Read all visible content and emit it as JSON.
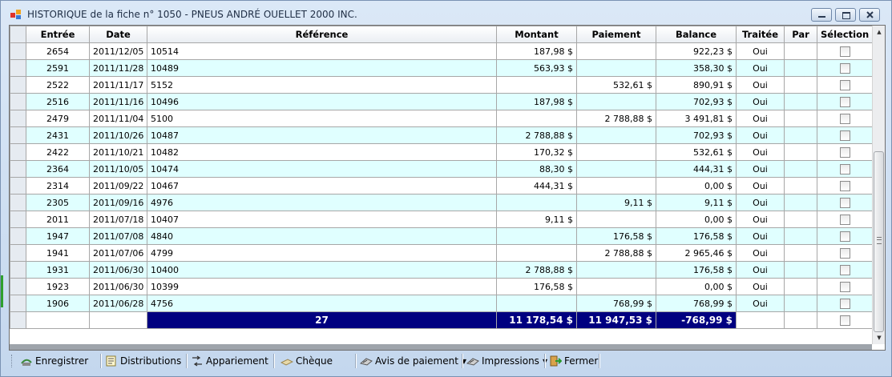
{
  "window": {
    "title": "HISTORIQUE de la fiche n° 1050 - PNEUS ANDRÉ OUELLET 2000 INC.",
    "icons": {
      "app": "app-window-icon",
      "minimize": "minimize-icon",
      "maximize": "maximize-icon",
      "close": "close-icon"
    }
  },
  "grid": {
    "columns": [
      "Entrée",
      "Date",
      "Référence",
      "Montant",
      "Paiement",
      "Balance",
      "Traitée",
      "Par",
      "Sélection"
    ],
    "rows": [
      {
        "entree": "2654",
        "date": "2011/12/05",
        "reference": "10514",
        "montant": "187,98 $",
        "paiement": "",
        "balance": "922,23 $",
        "traitee": "Oui",
        "par": "",
        "selected": false
      },
      {
        "entree": "2591",
        "date": "2011/11/28",
        "reference": "10489",
        "montant": "563,93 $",
        "paiement": "",
        "balance": "358,30 $",
        "traitee": "Oui",
        "par": "",
        "selected": false
      },
      {
        "entree": "2522",
        "date": "2011/11/17",
        "reference": "5152",
        "montant": "",
        "paiement": "532,61 $",
        "balance": "890,91 $",
        "traitee": "Oui",
        "par": "",
        "selected": false
      },
      {
        "entree": "2516",
        "date": "2011/11/16",
        "reference": "10496",
        "montant": "187,98 $",
        "paiement": "",
        "balance": "702,93 $",
        "traitee": "Oui",
        "par": "",
        "selected": false
      },
      {
        "entree": "2479",
        "date": "2011/11/04",
        "reference": "5100",
        "montant": "",
        "paiement": "2 788,88 $",
        "balance": "3 491,81 $",
        "traitee": "Oui",
        "par": "",
        "selected": false
      },
      {
        "entree": "2431",
        "date": "2011/10/26",
        "reference": "10487",
        "montant": "2 788,88 $",
        "paiement": "",
        "balance": "702,93 $",
        "traitee": "Oui",
        "par": "",
        "selected": false
      },
      {
        "entree": "2422",
        "date": "2011/10/21",
        "reference": "10482",
        "montant": "170,32 $",
        "paiement": "",
        "balance": "532,61 $",
        "traitee": "Oui",
        "par": "",
        "selected": false
      },
      {
        "entree": "2364",
        "date": "2011/10/05",
        "reference": "10474",
        "montant": "88,30 $",
        "paiement": "",
        "balance": "444,31 $",
        "traitee": "Oui",
        "par": "",
        "selected": false
      },
      {
        "entree": "2314",
        "date": "2011/09/22",
        "reference": "10467",
        "montant": "444,31 $",
        "paiement": "",
        "balance": "0,00 $",
        "traitee": "Oui",
        "par": "",
        "selected": false
      },
      {
        "entree": "2305",
        "date": "2011/09/16",
        "reference": "4976",
        "montant": "",
        "paiement": "9,11 $",
        "balance": "9,11 $",
        "traitee": "Oui",
        "par": "",
        "selected": false
      },
      {
        "entree": "2011",
        "date": "2011/07/18",
        "reference": "10407",
        "montant": "9,11 $",
        "paiement": "",
        "balance": "0,00 $",
        "traitee": "Oui",
        "par": "",
        "selected": false
      },
      {
        "entree": "1947",
        "date": "2011/07/08",
        "reference": "4840",
        "montant": "",
        "paiement": "176,58 $",
        "balance": "176,58 $",
        "traitee": "Oui",
        "par": "",
        "selected": false
      },
      {
        "entree": "1941",
        "date": "2011/07/06",
        "reference": "4799",
        "montant": "",
        "paiement": "2 788,88 $",
        "balance": "2 965,46 $",
        "traitee": "Oui",
        "par": "",
        "selected": false
      },
      {
        "entree": "1931",
        "date": "2011/06/30",
        "reference": "10400",
        "montant": "2 788,88 $",
        "paiement": "",
        "balance": "176,58 $",
        "traitee": "Oui",
        "par": "",
        "selected": false
      },
      {
        "entree": "1923",
        "date": "2011/06/30",
        "reference": "10399",
        "montant": "176,58 $",
        "paiement": "",
        "balance": "0,00 $",
        "traitee": "Oui",
        "par": "",
        "selected": false
      },
      {
        "entree": "1906",
        "date": "2011/06/28",
        "reference": "4756",
        "montant": "",
        "paiement": "768,99 $",
        "balance": "768,99 $",
        "traitee": "Oui",
        "par": "",
        "selected": false
      }
    ],
    "totals": {
      "count": "27",
      "montant": "11 178,54 $",
      "paiement": "11 947,53 $",
      "balance": "-768,99 $"
    },
    "colors": {
      "alt_row": "#e0ffff",
      "total_bg": "#000080"
    }
  },
  "toolbar": {
    "items": [
      {
        "label": "Enregistrer",
        "icon": "save-icon"
      },
      {
        "label": "Distributions",
        "icon": "distributions-icon"
      },
      {
        "label": "Appariement",
        "icon": "match-icon"
      },
      {
        "label": "Chèque",
        "icon": "cheque-icon"
      },
      {
        "label": "Avis de paiement",
        "icon": "payment-notice-icon"
      },
      {
        "label": "Impressions",
        "icon": "print-icon"
      },
      {
        "label": "Fermer",
        "icon": "close-door-icon"
      }
    ]
  }
}
